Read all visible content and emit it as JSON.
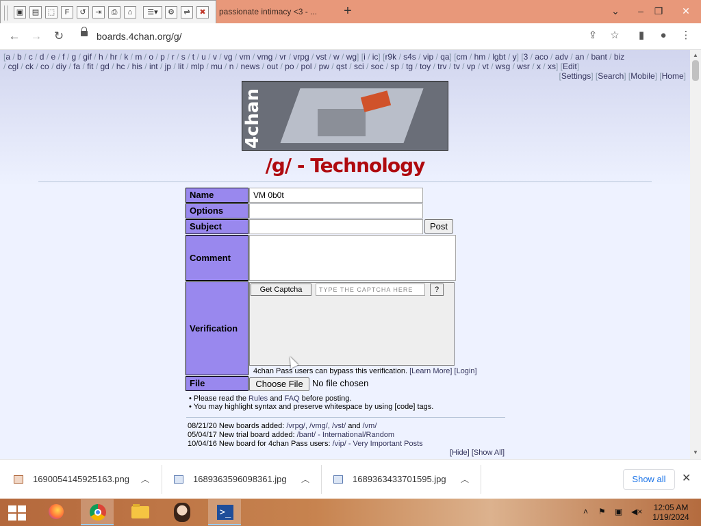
{
  "browser": {
    "tab_title": "passionate intimacy <3 - ...",
    "new_tab_glyph": "+",
    "url": "boards.4chan.org/g/",
    "window_controls": {
      "dropdown": "⌄",
      "minimize": "–",
      "restore": "❐",
      "close": "✕"
    }
  },
  "capture_toolbar": {
    "buttons": [
      "window-capture",
      "region-capture",
      "freehand",
      "fullscreen",
      "repeat",
      "export",
      "print",
      "stamp",
      "options",
      "settings",
      "minimize",
      "close"
    ]
  },
  "board_nav": {
    "row1": [
      "a",
      "b",
      "c",
      "d",
      "e",
      "f",
      "g",
      "gif",
      "h",
      "hr",
      "k",
      "m",
      "o",
      "p",
      "r",
      "s",
      "t",
      "u",
      "v",
      "vg",
      "vm",
      "vmg",
      "vr",
      "vrpg",
      "vst",
      "w",
      "wg"
    ],
    "row1b": [
      "i",
      "ic"
    ],
    "row1c": [
      "r9k",
      "s4s",
      "vip",
      "qa"
    ],
    "row1d": [
      "cm",
      "hm",
      "lgbt",
      "y"
    ],
    "row1e": [
      "3",
      "aco",
      "adv",
      "an",
      "bant",
      "biz"
    ],
    "row2": [
      "cgl",
      "ck",
      "co",
      "diy",
      "fa",
      "fit",
      "gd",
      "hc",
      "his",
      "int",
      "jp",
      "lit",
      "mlp",
      "mu",
      "n",
      "news",
      "out",
      "po",
      "pol",
      "pw",
      "qst",
      "sci",
      "soc",
      "sp",
      "tg",
      "toy",
      "trv",
      "tv",
      "vp",
      "vt",
      "wsg",
      "wsr",
      "x",
      "xs"
    ],
    "edit": "Edit",
    "right_links": [
      "Settings",
      "Search",
      "Mobile",
      "Home"
    ]
  },
  "banner": {
    "logo_text": "4chan"
  },
  "board_title": "/g/ - Technology",
  "post_form": {
    "name_label": "Name",
    "name_value": "VM 0b0t",
    "options_label": "Options",
    "subject_label": "Subject",
    "post_button": "Post",
    "comment_label": "Comment",
    "verification_label": "Verification",
    "captcha_button": "Get Captcha",
    "captcha_placeholder": "TYPE THE CAPTCHA HERE",
    "captcha_help": "?",
    "pass_note": "4chan Pass users can bypass this verification.",
    "learn_more": "[Learn More]",
    "login": "[Login]",
    "file_label": "File",
    "file_button": "Choose File",
    "file_status": "No file chosen"
  },
  "rules": {
    "line1_pre": "• Please read the ",
    "line1_rules": "Rules",
    "line1_and": " and ",
    "line1_faq": "FAQ",
    "line1_post": " before posting.",
    "line2": "• You may highlight syntax and preserve whitespace by using [code] tags."
  },
  "news": [
    {
      "date": "08/21/20",
      "text": "New boards added: ",
      "links": "/vrpg/, /vmg/, /vst/",
      "tail_and": " and ",
      "tail_link": "/vm/"
    },
    {
      "date": "05/04/17",
      "text": "New trial board added: ",
      "links": "/bant/ - International/Random",
      "tail_and": "",
      "tail_link": ""
    },
    {
      "date": "10/04/16",
      "text": "New board for 4chan Pass users: ",
      "links": "/vip/ - Very Important Posts",
      "tail_and": "",
      "tail_link": ""
    }
  ],
  "news_toggle": {
    "hide": "[Hide]",
    "show_all": "[Show All]"
  },
  "downloads": {
    "items": [
      {
        "name": "1690054145925163.png",
        "type": "png"
      },
      {
        "name": "1689363596098361.jpg",
        "type": "jpg"
      },
      {
        "name": "1689363433701595.jpg",
        "type": "jpg"
      }
    ],
    "show_all": "Show all",
    "close_glyph": "✕"
  },
  "taskbar": {
    "apps": [
      "firefox",
      "chrome",
      "file-explorer",
      "portrait-app",
      "powershell"
    ],
    "ps_glyph": ">_",
    "clock_time": "12:05 AM",
    "clock_date": "1/19/2024"
  },
  "colors": {
    "tab_strip": "#e8987a",
    "board_title": "#af0a0f",
    "form_label": "#9988ee",
    "link": "#34345c"
  }
}
